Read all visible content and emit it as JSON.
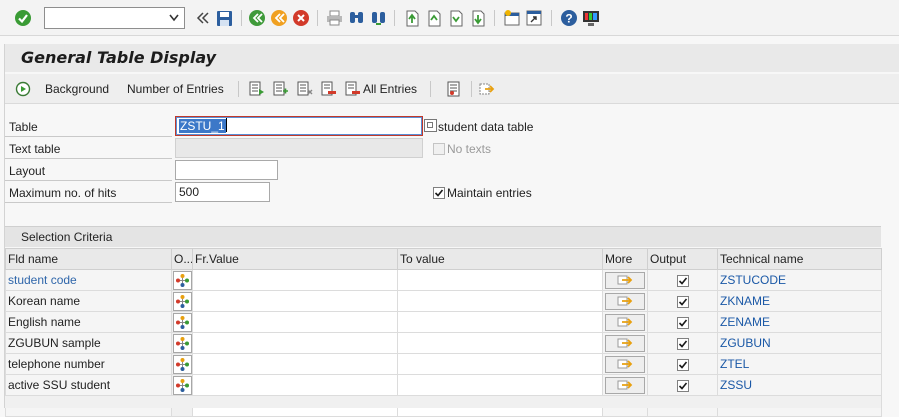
{
  "command_field": {
    "value": "",
    "placeholder": ""
  },
  "window_title": "General Table Display",
  "app_toolbar": {
    "background_label": "Background",
    "number_of_entries_label": "Number of Entries",
    "all_entries_label": "All Entries"
  },
  "form": {
    "table_label": "Table",
    "table_value": "ZSTU_1",
    "table_description": "student data table",
    "text_table_label": "Text table",
    "text_table_value": "",
    "no_texts_label": "No texts",
    "no_texts_checked": false,
    "layout_label": "Layout",
    "layout_value": "",
    "max_hits_label": "Maximum no. of hits",
    "max_hits_value": "500",
    "maintain_entries_label": "Maintain entries",
    "maintain_entries_checked": true
  },
  "selection": {
    "title": "Selection Criteria",
    "columns": [
      "Fld name",
      "O...",
      "Fr.Value",
      "To value",
      "More",
      "Output",
      "Technical name"
    ],
    "rows": [
      {
        "fld_name": "student code",
        "fr_value": "",
        "to_value": "",
        "output": true,
        "technical_name": "ZSTUCODE"
      },
      {
        "fld_name": "Korean name",
        "fr_value": "",
        "to_value": "",
        "output": true,
        "technical_name": "ZKNAME"
      },
      {
        "fld_name": "English name",
        "fr_value": "",
        "to_value": "",
        "output": true,
        "technical_name": "ZENAME"
      },
      {
        "fld_name": "ZGUBUN sample",
        "fr_value": "",
        "to_value": "",
        "output": true,
        "technical_name": "ZGUBUN"
      },
      {
        "fld_name": "telephone number",
        "fr_value": "",
        "to_value": "",
        "output": true,
        "technical_name": "ZTEL"
      },
      {
        "fld_name": "active SSU student",
        "fr_value": "",
        "to_value": "",
        "output": true,
        "technical_name": "ZSSU"
      }
    ]
  },
  "colors": {
    "link_blue": "#2f66aa",
    "tech_blue": "#1a58a6",
    "focus_red": "#c0392b",
    "selection_blue": "#3c78c8"
  }
}
